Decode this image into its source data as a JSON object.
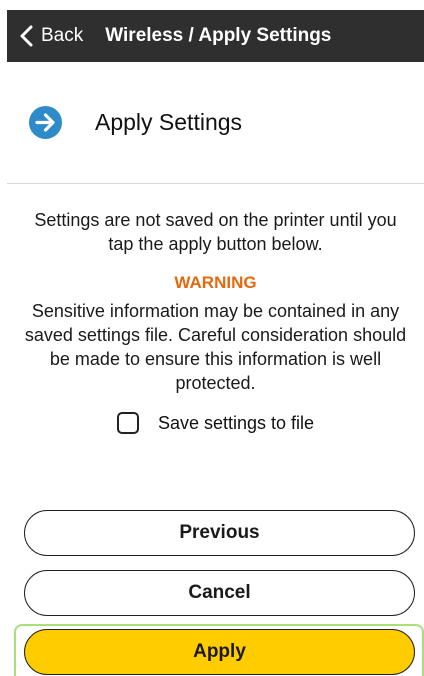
{
  "navbar": {
    "back_label": "Back",
    "title": "Wireless / Apply Settings"
  },
  "header": {
    "title": "Apply Settings",
    "icon": "arrow-right-circle-icon",
    "icon_color": "#2e8bc9"
  },
  "content": {
    "intro": "Settings are not saved on the printer until you tap the apply button below.",
    "warning_title": "WARNING",
    "warning_color": "#e36a0f",
    "warning_text": "Sensitive information may be contained in any saved settings file. Careful consideration should be made to ensure this information is well protected."
  },
  "checkbox": {
    "label": "Save settings to file",
    "checked": false
  },
  "buttons": {
    "previous": "Previous",
    "cancel": "Cancel",
    "apply": "Apply",
    "apply_color": "#ffcc00"
  }
}
